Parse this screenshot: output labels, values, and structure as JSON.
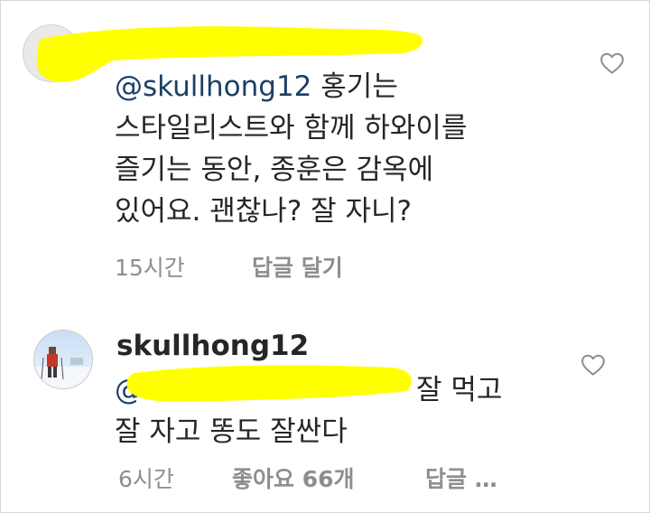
{
  "comments": [
    {
      "mention": "@skullhong12",
      "text": " 홍기는\n스타일리스트와 함께 하와이를\n즐기는 동안, 종훈은 감옥에\n있어요. 괜찮나? 잘 자니?",
      "time": "15시간",
      "reply": "답글 달기",
      "redaction_color": "#ffff00"
    },
    {
      "username": "skullhong12",
      "mention_fragment": "@",
      "text_after_redaction": "잘 먹고",
      "text_line2": "잘 자고 똥도 잘싼다",
      "time": "6시간",
      "likes": "좋아요 66개",
      "reply": "답글 …",
      "redaction_color": "#ffff00"
    }
  ],
  "icons": {
    "like": "heart-outline-icon"
  },
  "colors": {
    "text": "#262626",
    "mention": "#1c3f66",
    "meta": "#8e8e8e"
  }
}
